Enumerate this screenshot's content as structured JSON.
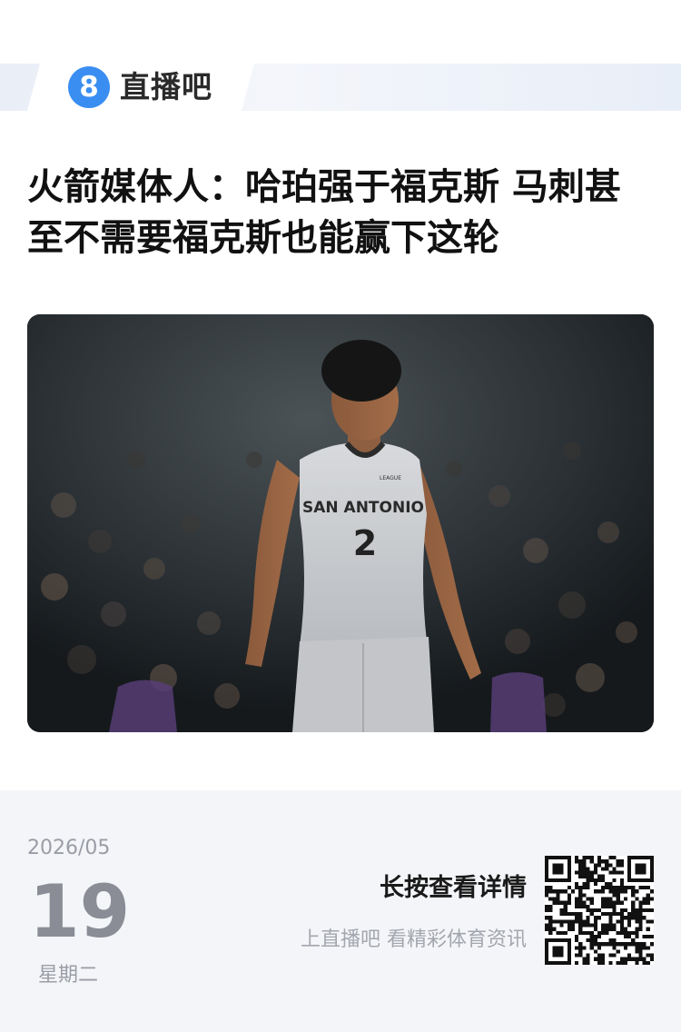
{
  "header": {
    "logo_icon": "number-8-circle-logo",
    "logo_numeral": "8",
    "brand_name": "直播吧",
    "brand_color": "#3a8ef2"
  },
  "article": {
    "title": "火箭媒体人：哈珀强于福克斯 马刺甚至不需要福克斯也能赢下这轮",
    "photo": {
      "jersey_text": "SAN ANTONIO",
      "jersey_number": "2",
      "jersey_tag": "LEAGUE"
    }
  },
  "footer": {
    "date_year_month": "2026/05",
    "date_day": "19",
    "date_weekday": "星期二",
    "cta_main": "长按查看详情",
    "cta_sub": "上直播吧 看精彩体育资讯",
    "qr_icon": "qr-code-icon"
  }
}
